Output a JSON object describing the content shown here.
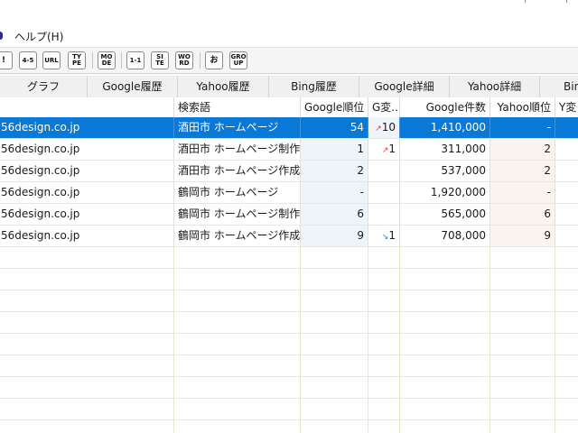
{
  "menubar": {
    "help_label": "ヘルプ(H)"
  },
  "toolbar": {
    "buttons": [
      "!",
      "4-5",
      "URL",
      "TY\nPE",
      "MO\nDE",
      "1-1",
      "SI\nTE",
      "WO\nRD",
      "お",
      "GRO\nUP"
    ]
  },
  "tabs": [
    "グラフ",
    "Google履歴",
    "Yahoo履歴",
    "Bing履歴",
    "Google詳細",
    "Yahoo詳細",
    "Bin"
  ],
  "columns": {
    "site": "",
    "keyword": "検索語",
    "google_rank": "Google順位",
    "g_change": "G変...",
    "google_count": "Google件数",
    "yahoo_rank": "Yahoo順位",
    "y_change": "Y変"
  },
  "rows": [
    {
      "site": "56design.co.jp",
      "keyword": "酒田市 ホームページ",
      "google_rank": "54",
      "g_dir": "up",
      "g_change": "10",
      "google_count": "1,410,000",
      "yahoo_rank": "-",
      "selected": true
    },
    {
      "site": "56design.co.jp",
      "keyword": "酒田市 ホームページ制作",
      "google_rank": "1",
      "g_dir": "up",
      "g_change": "1",
      "google_count": "311,000",
      "yahoo_rank": "2",
      "selected": false
    },
    {
      "site": "56design.co.jp",
      "keyword": "酒田市 ホームページ作成",
      "google_rank": "2",
      "g_dir": "",
      "g_change": "",
      "google_count": "537,000",
      "yahoo_rank": "2",
      "selected": false
    },
    {
      "site": "56design.co.jp",
      "keyword": "鶴岡市 ホームページ",
      "google_rank": "-",
      "g_dir": "",
      "g_change": "",
      "google_count": "1,920,000",
      "yahoo_rank": "-",
      "selected": false
    },
    {
      "site": "56design.co.jp",
      "keyword": "鶴岡市 ホームページ制作",
      "google_rank": "6",
      "g_dir": "",
      "g_change": "",
      "google_count": "565,000",
      "yahoo_rank": "6",
      "selected": false
    },
    {
      "site": "56design.co.jp",
      "keyword": "鶴岡市 ホームページ作成",
      "google_rank": "9",
      "g_dir": "down",
      "g_change": "1",
      "google_count": "708,000",
      "yahoo_rank": "9",
      "selected": false
    }
  ],
  "colors": {
    "selection": "#0a78d7",
    "arrow_up": "#e03b3b",
    "arrow_down": "#1e7fd6"
  }
}
